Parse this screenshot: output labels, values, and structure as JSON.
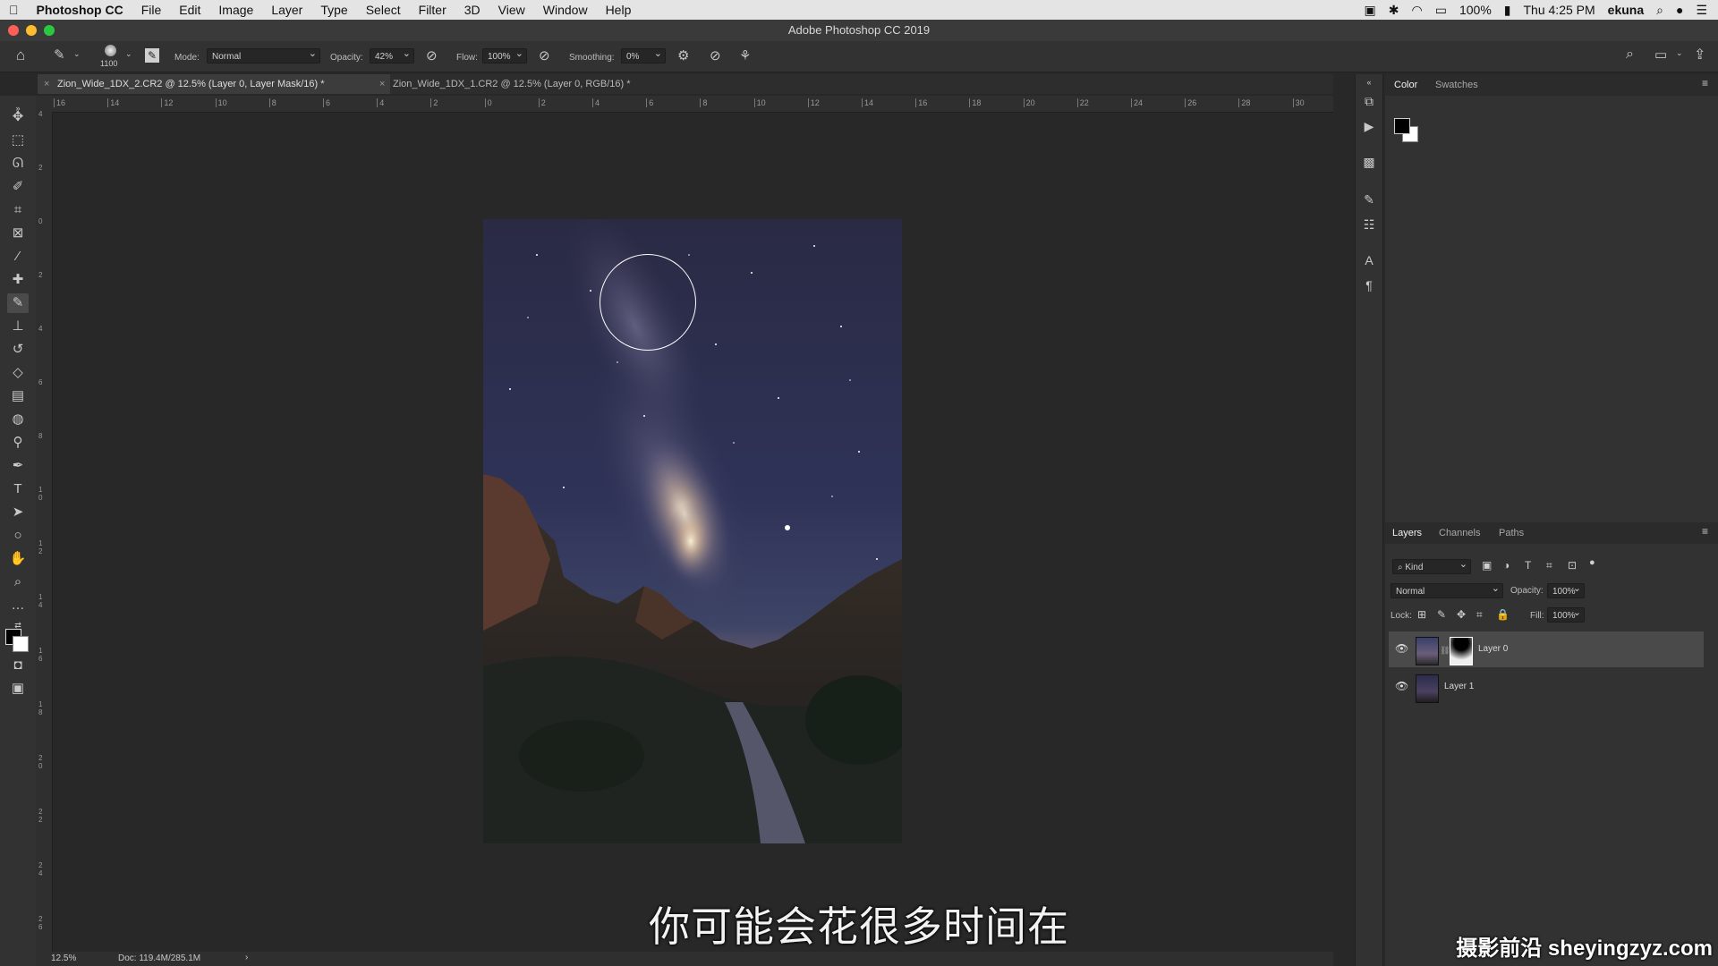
{
  "menubar": {
    "app_name": "Photoshop CC",
    "items": [
      "File",
      "Edit",
      "Image",
      "Layer",
      "Type",
      "Select",
      "Filter",
      "3D",
      "View",
      "Window",
      "Help"
    ],
    "battery": "100%",
    "clock": "Thu 4:25 PM",
    "user": "ekuna"
  },
  "window": {
    "title": "Adobe Photoshop CC 2019"
  },
  "options": {
    "brush_size": "1100",
    "mode_label": "Mode:",
    "mode_value": "Normal",
    "opacity_label": "Opacity:",
    "opacity_value": "42%",
    "flow_label": "Flow:",
    "flow_value": "100%",
    "smoothing_label": "Smoothing:",
    "smoothing_value": "0%"
  },
  "tabs": [
    {
      "label": "Zion_Wide_1DX_2.CR2 @ 12.5% (Layer 0, Layer Mask/16) *",
      "active": true
    },
    {
      "label": "Zion_Wide_1DX_1.CR2 @ 12.5% (Layer 0, RGB/16) *",
      "active": false
    }
  ],
  "ruler_h": [
    "16",
    "14",
    "12",
    "10",
    "8",
    "6",
    "4",
    "2",
    "0",
    "2",
    "4",
    "6",
    "8",
    "10",
    "12",
    "14",
    "16",
    "18",
    "20",
    "22",
    "24",
    "26",
    "28",
    "30"
  ],
  "ruler_v": [
    "4",
    "2",
    "0",
    "2",
    "4",
    "6",
    "8",
    "1\n0",
    "1\n2",
    "1\n4",
    "1\n6",
    "1\n8",
    "2\n0",
    "2\n2",
    "2\n4",
    "2\n6"
  ],
  "status": {
    "zoom": "12.5%",
    "doc": "Doc: 119.4M/285.1M"
  },
  "subtitle": "你可能会花很多时间在",
  "watermark": "摄影前沿 sheyingzyz.com",
  "panels": {
    "color_tabs": [
      "Color",
      "Swatches"
    ],
    "layers_tabs": [
      "Layers",
      "Channels",
      "Paths"
    ],
    "kind_label": "Kind",
    "blend_mode": "Normal",
    "opacity_label": "Opacity:",
    "opacity_value": "100%",
    "lock_label": "Lock:",
    "fill_label": "Fill:",
    "fill_value": "100%",
    "layers": [
      {
        "name": "Layer 0",
        "selected": true
      },
      {
        "name": "Layer 1",
        "selected": false
      }
    ]
  }
}
